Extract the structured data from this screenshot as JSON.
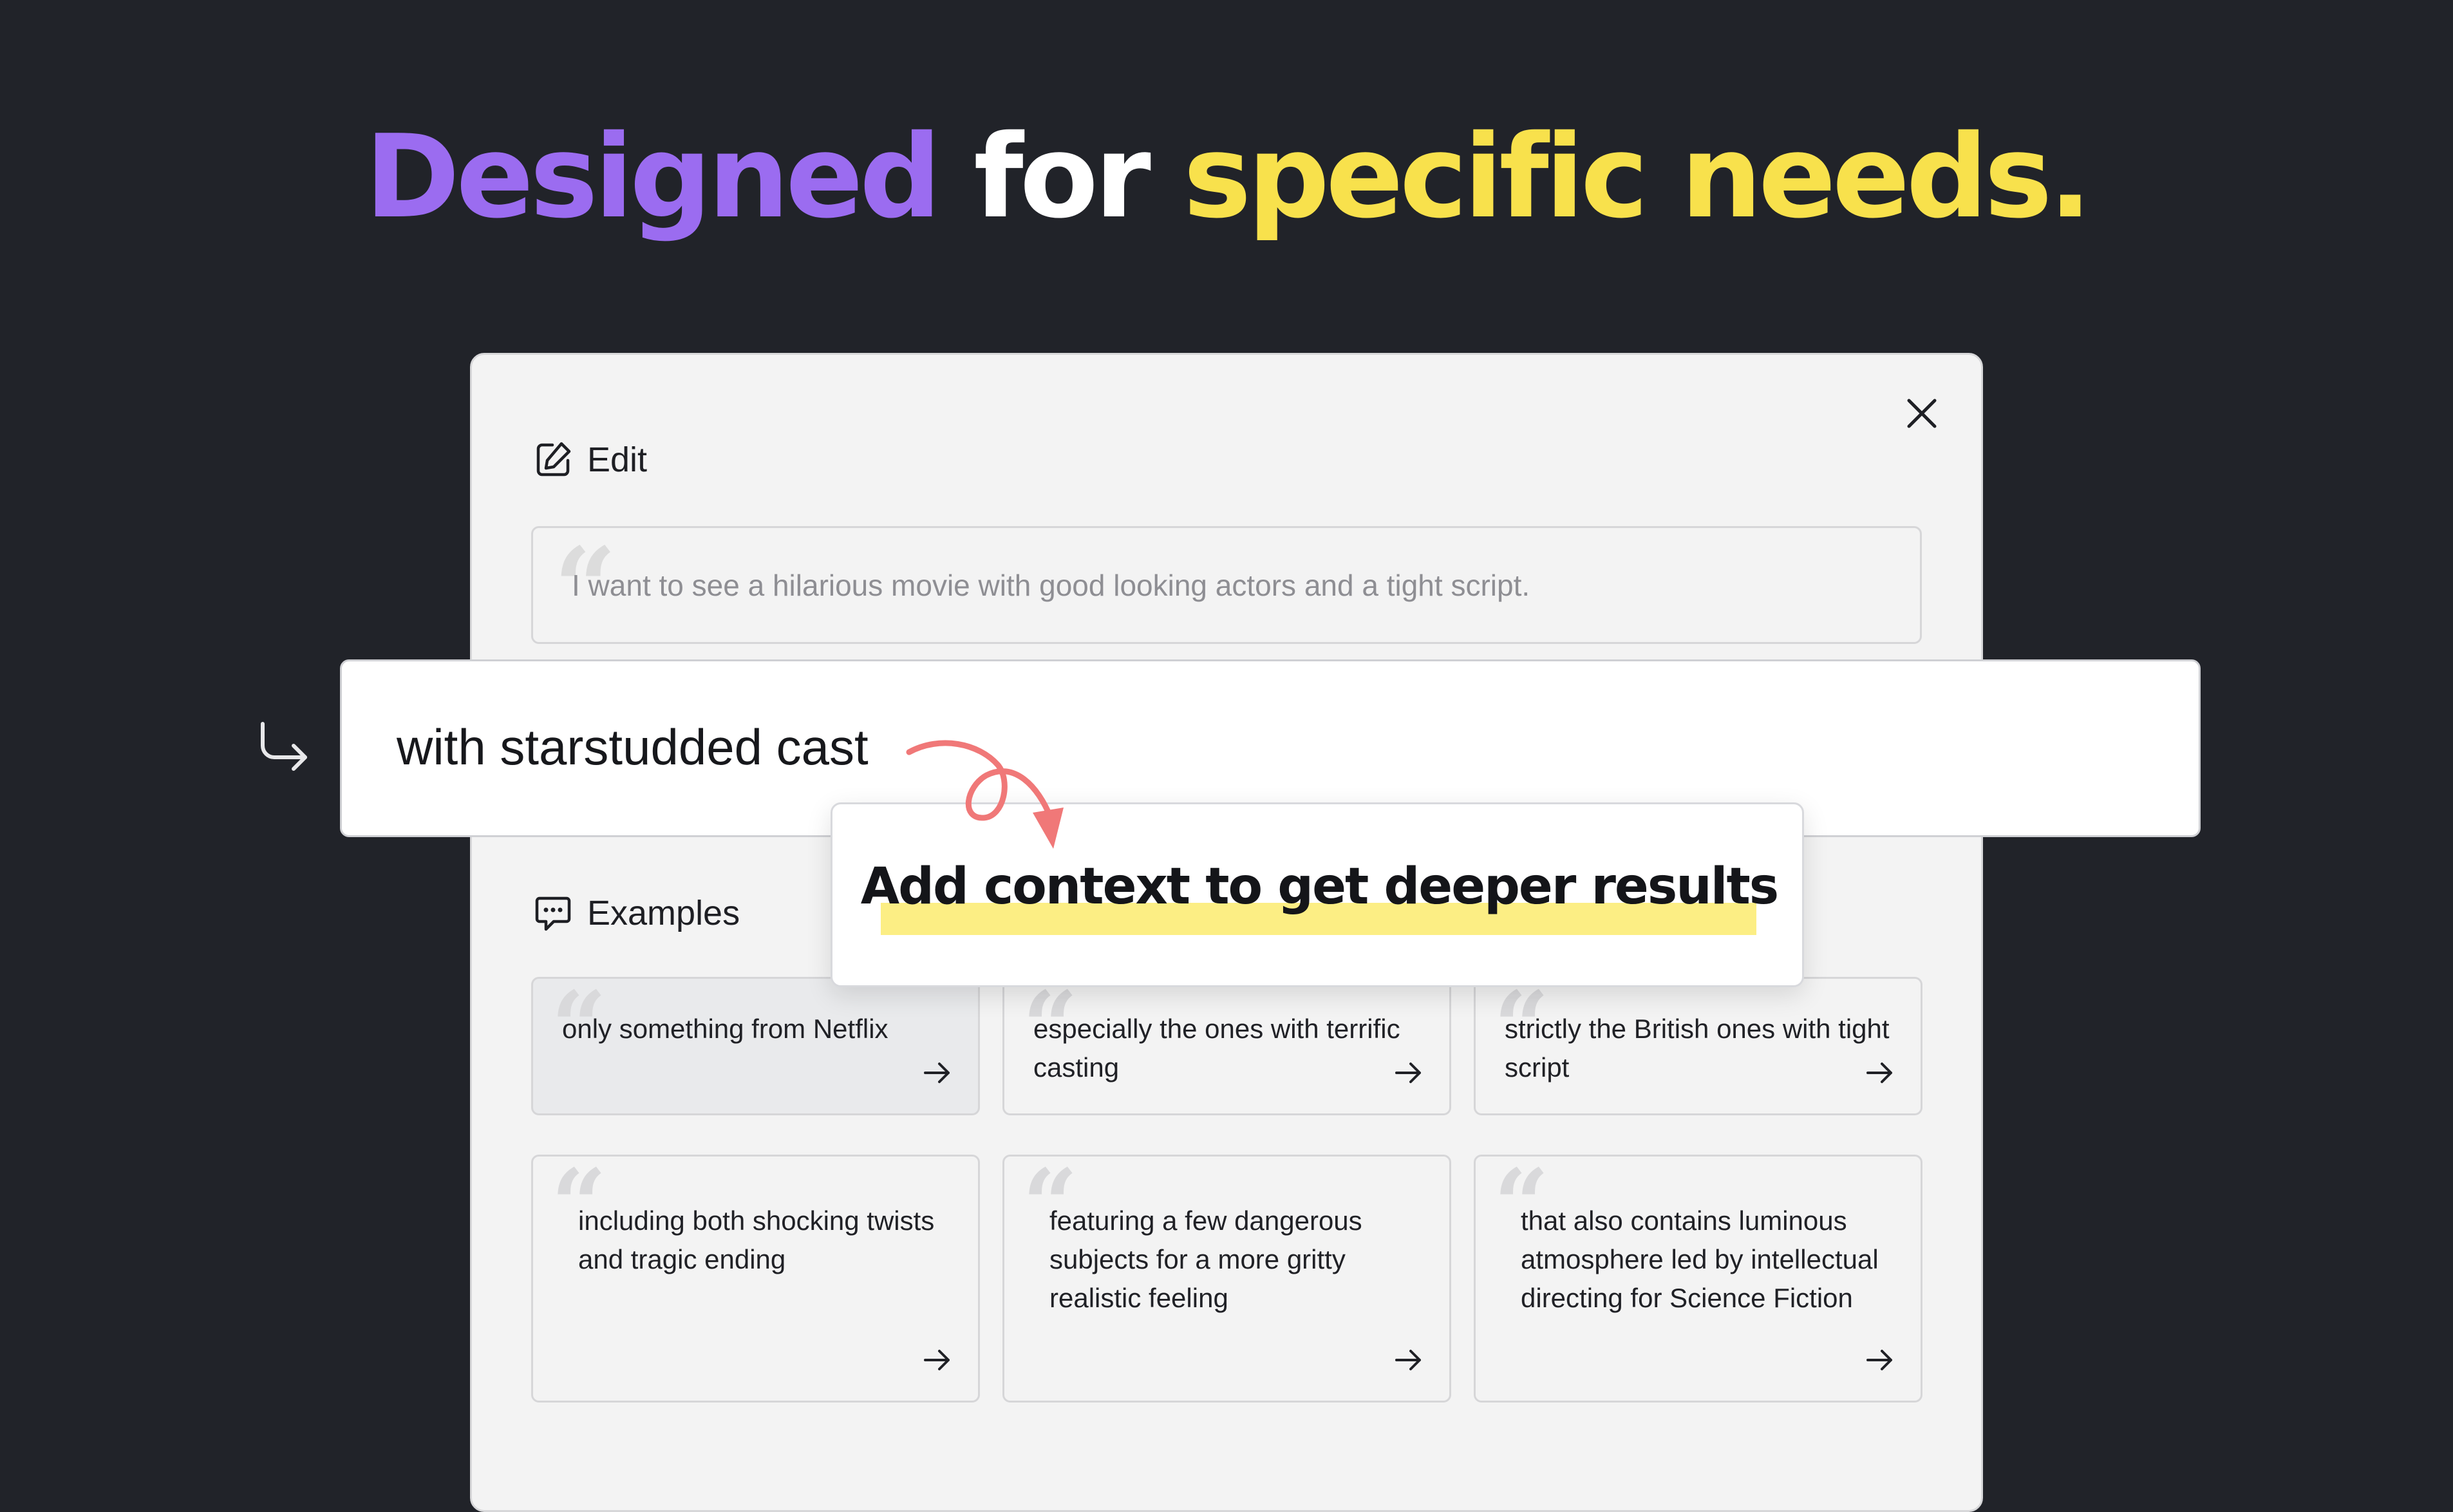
{
  "headline": {
    "word1": "Designed",
    "word2": "for",
    "word3": "specific needs."
  },
  "colors": {
    "purple": "#9b6cf0",
    "yellow": "#f8e14c",
    "background": "#212329",
    "accent_arrow": "#f07878",
    "highlight": "#fcee84"
  },
  "dialog": {
    "edit_label": "Edit",
    "prompt_text": "I want to see a hilarious movie with good looking actors and a tight script.",
    "context_value": "with starstudded cast",
    "tooltip": "Add context to get deeper results",
    "examples_label": "Examples",
    "examples": [
      {
        "text": "only something from Netflix"
      },
      {
        "text": "especially the ones with terrific casting"
      },
      {
        "text": "strictly the British ones with tight script"
      },
      {
        "text": "including both shocking twists and tragic ending"
      },
      {
        "text": "featuring a few dangerous subjects for a more gritty realistic feeling"
      },
      {
        "text": "that also contains luminous atmosphere led by intellectual directing for Science Fiction"
      }
    ]
  },
  "icons": {
    "edit": "edit-icon",
    "close": "close-icon",
    "examples": "chat-icon",
    "return": "return-arrow-icon",
    "card_arrow": "arrow-right-icon"
  }
}
